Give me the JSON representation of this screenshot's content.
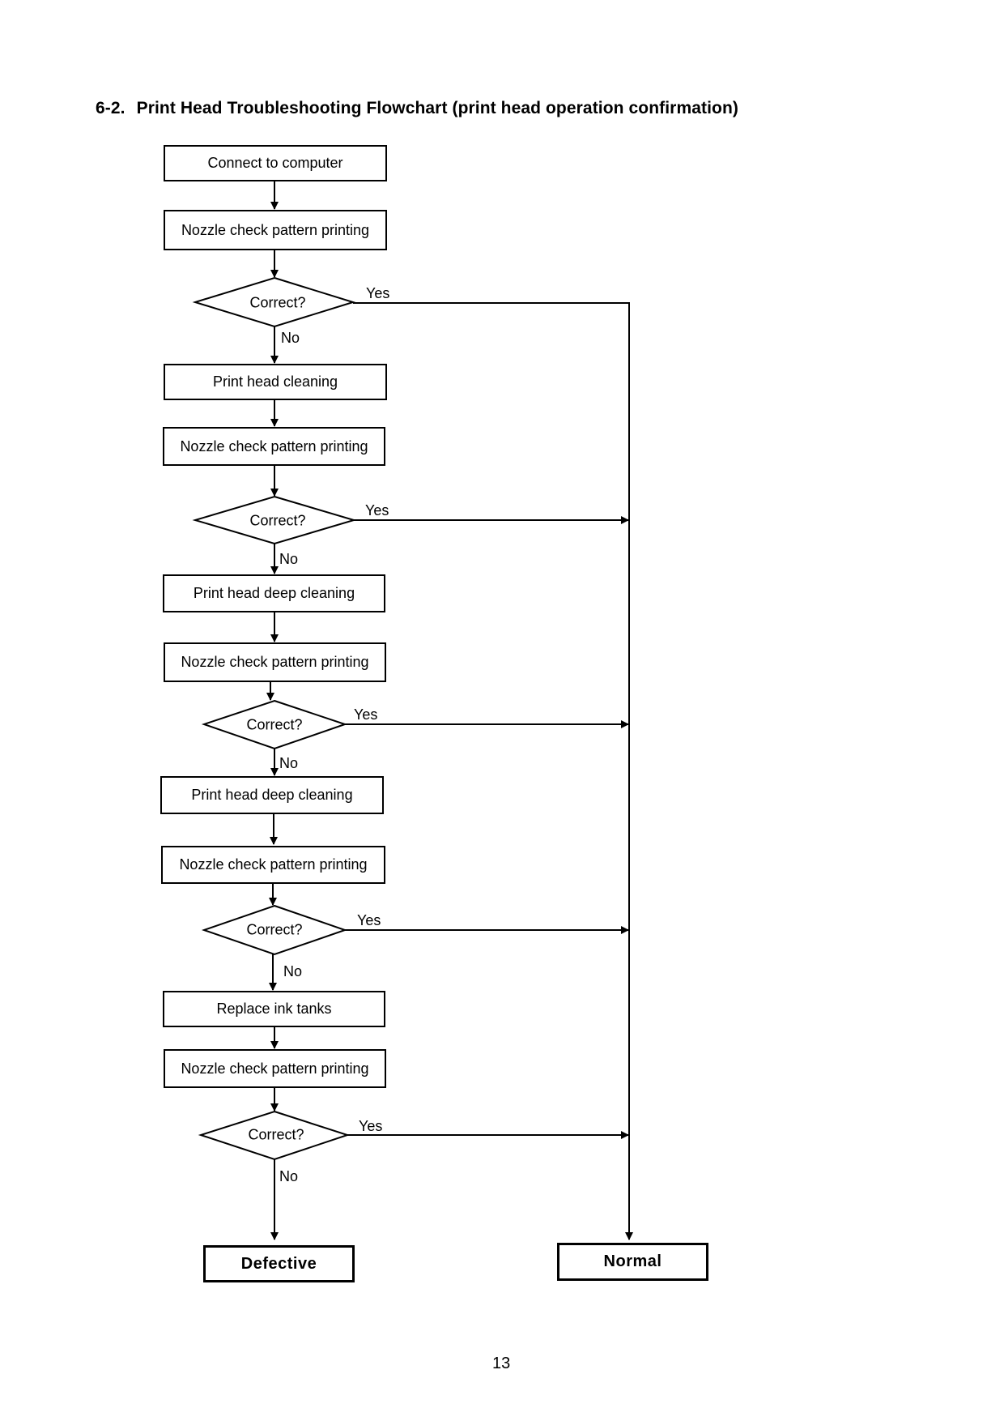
{
  "title": {
    "number": "6-2.",
    "text": "Print Head Troubleshooting Flowchart (print head operation confirmation)"
  },
  "flowchart": {
    "steps": [
      {
        "id": "connect",
        "type": "process",
        "label": "Connect to computer"
      },
      {
        "id": "nozzle1",
        "type": "process",
        "label": "Nozzle check pattern printing"
      },
      {
        "id": "decision1",
        "type": "decision",
        "label": "Correct?",
        "yes": "normal",
        "no": "cleaning"
      },
      {
        "id": "cleaning",
        "type": "process",
        "label": "Print head cleaning"
      },
      {
        "id": "nozzle2",
        "type": "process",
        "label": "Nozzle check pattern printing"
      },
      {
        "id": "decision2",
        "type": "decision",
        "label": "Correct?",
        "yes": "normal",
        "no": "deep1"
      },
      {
        "id": "deep1",
        "type": "process",
        "label": "Print head deep cleaning"
      },
      {
        "id": "nozzle3",
        "type": "process",
        "label": "Nozzle check pattern printing"
      },
      {
        "id": "decision3",
        "type": "decision",
        "label": "Correct?",
        "yes": "normal",
        "no": "deep2"
      },
      {
        "id": "deep2",
        "type": "process",
        "label": "Print head deep cleaning"
      },
      {
        "id": "nozzle4",
        "type": "process",
        "label": "Nozzle check pattern printing"
      },
      {
        "id": "decision4",
        "type": "decision",
        "label": "Correct?",
        "yes": "normal",
        "no": "replace"
      },
      {
        "id": "replace",
        "type": "process",
        "label": "Replace ink tanks"
      },
      {
        "id": "nozzle5",
        "type": "process",
        "label": "Nozzle check pattern printing"
      },
      {
        "id": "decision5",
        "type": "decision",
        "label": "Correct?",
        "yes": "normal",
        "no": "defective"
      }
    ],
    "terminals": {
      "defective": "Defective",
      "normal": "Normal"
    },
    "edge_labels": {
      "yes": "Yes",
      "no": "No"
    }
  },
  "footer": {
    "page_number": "13"
  }
}
